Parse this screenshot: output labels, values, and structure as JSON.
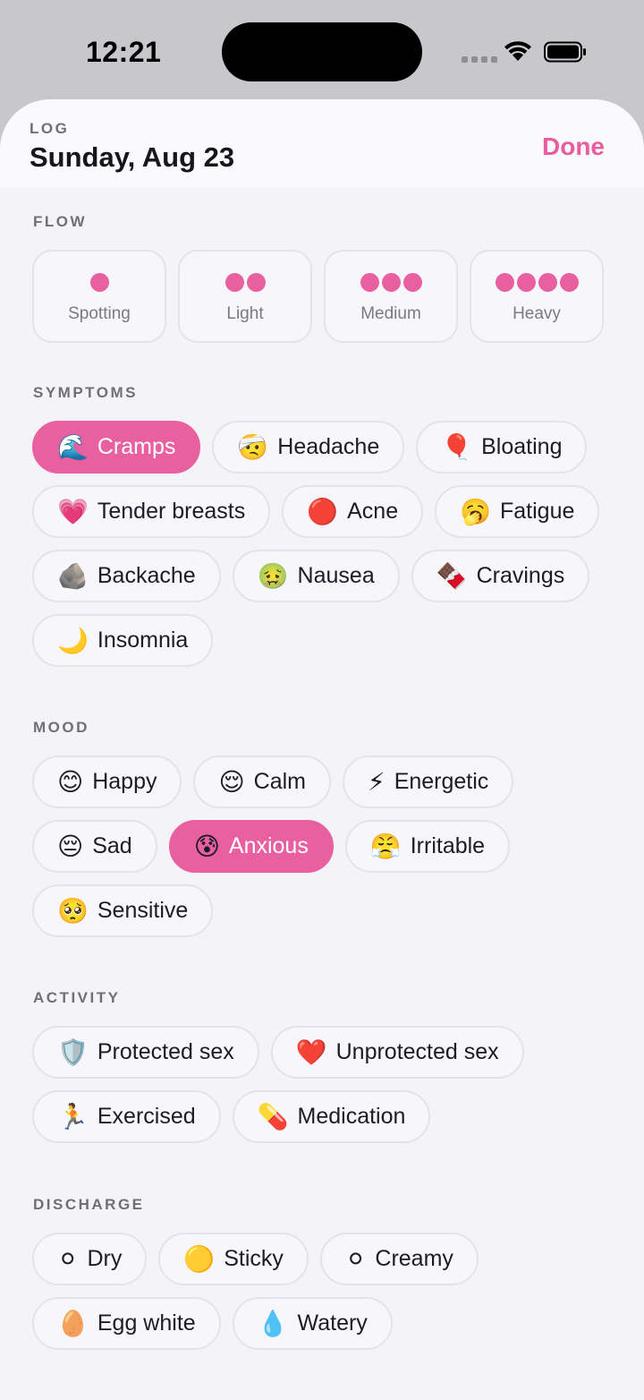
{
  "status_bar": {
    "time": "12:21"
  },
  "header": {
    "eyebrow": "LOG",
    "title": "Sunday, Aug 23",
    "done_label": "Done"
  },
  "accent_color": "#e8609f",
  "flow": {
    "label": "FLOW",
    "options": [
      {
        "label": "Spotting",
        "dots": 1
      },
      {
        "label": "Light",
        "dots": 2
      },
      {
        "label": "Medium",
        "dots": 3
      },
      {
        "label": "Heavy",
        "dots": 4
      }
    ]
  },
  "symptoms": {
    "label": "SYMPTOMS",
    "items": [
      {
        "icon": "🌊",
        "label": "Cramps",
        "selected": true
      },
      {
        "icon": "🤕",
        "label": "Headache",
        "selected": false
      },
      {
        "icon": "🎈",
        "label": "Bloating",
        "selected": false
      },
      {
        "icon": "💗",
        "label": "Tender breasts",
        "selected": false
      },
      {
        "icon": "🔴",
        "label": "Acne",
        "selected": false
      },
      {
        "icon": "🥱",
        "label": "Fatigue",
        "selected": false
      },
      {
        "icon": "🪨",
        "label": "Backache",
        "selected": false
      },
      {
        "icon": "🤢",
        "label": "Nausea",
        "selected": false
      },
      {
        "icon": "🍫",
        "label": "Cravings",
        "selected": false
      },
      {
        "icon": "🌙",
        "label": "Insomnia",
        "selected": false
      }
    ]
  },
  "mood": {
    "label": "MOOD",
    "items": [
      {
        "icon": "😊",
        "label": "Happy",
        "selected": false
      },
      {
        "icon": "😌",
        "label": "Calm",
        "selected": false
      },
      {
        "icon": "⚡",
        "label": "Energetic",
        "selected": false
      },
      {
        "icon": "😔",
        "label": "Sad",
        "selected": false
      },
      {
        "icon": "😰",
        "label": "Anxious",
        "selected": true
      },
      {
        "icon": "😤",
        "label": "Irritable",
        "selected": false
      },
      {
        "icon": "🥺",
        "label": "Sensitive",
        "selected": false
      }
    ]
  },
  "activity": {
    "label": "ACTIVITY",
    "items": [
      {
        "icon": "🛡️",
        "label": "Protected sex",
        "selected": false
      },
      {
        "icon": "❤️",
        "label": "Unprotected sex",
        "selected": false
      },
      {
        "icon": "🏃",
        "label": "Exercised",
        "selected": false
      },
      {
        "icon": "💊",
        "label": "Medication",
        "selected": false
      }
    ]
  },
  "discharge": {
    "label": "DISCHARGE",
    "items": [
      {
        "icon": "⚪",
        "label": "Dry",
        "selected": false
      },
      {
        "icon": "🟡",
        "label": "Sticky",
        "selected": false
      },
      {
        "icon": "⚪",
        "label": "Creamy",
        "selected": false
      },
      {
        "icon": "🥚",
        "label": "Egg white",
        "selected": false
      },
      {
        "icon": "💧",
        "label": "Watery",
        "selected": false
      }
    ]
  }
}
